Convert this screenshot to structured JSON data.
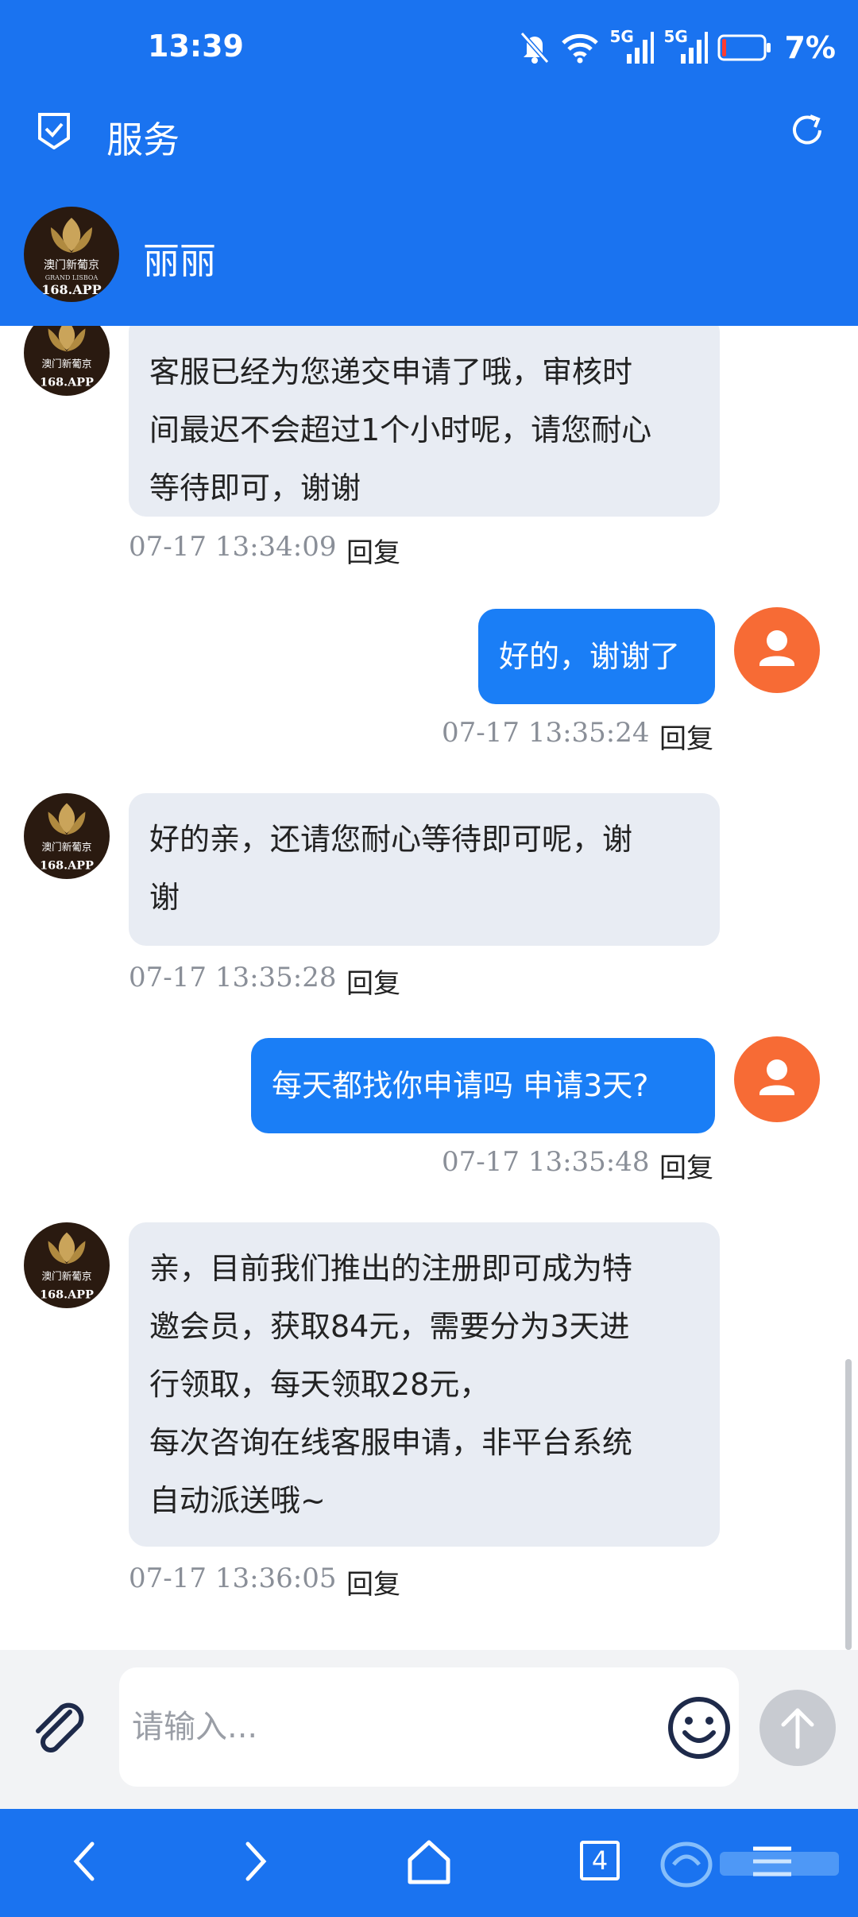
{
  "status_bar": {
    "time": "13:39",
    "signal1_label": "5G",
    "signal2_label": "5G",
    "battery": "7%"
  },
  "header": {
    "title": "服务",
    "agent_name": "丽丽"
  },
  "colors": {
    "primary": "#1a73f0",
    "out_bubble": "#1a7ef6",
    "in_bubble": "#e8ecf3",
    "user_avatar": "#f76b35"
  },
  "messages": [
    {
      "from": "agent",
      "lines": [
        "客服已经为您递交申请了哦，审核时",
        "间最迟不会超过1个小时呢，请您耐心",
        "等待即可，谢谢"
      ],
      "time": "07-17 13:34:09",
      "reply": "回复"
    },
    {
      "from": "user",
      "lines": [
        "好的，谢谢了"
      ],
      "time": "07-17 13:35:24",
      "reply": "回复"
    },
    {
      "from": "agent",
      "lines": [
        "好的亲，还请您耐心等待即可呢，谢",
        "谢"
      ],
      "time": "07-17 13:35:28",
      "reply": "回复"
    },
    {
      "from": "user",
      "lines": [
        "每天都找你申请吗 申请3天?"
      ],
      "time": "07-17 13:35:48",
      "reply": "回复"
    },
    {
      "from": "agent",
      "lines": [
        "亲，目前我们推出的注册即可成为特",
        "邀会员，获取84元，需要分为3天进",
        "行领取，每天领取28元，",
        "每次咨询在线客服申请，非平台系统",
        "自动派送哦~"
      ],
      "time": "07-17 13:36:05",
      "reply": "回复"
    }
  ],
  "agent_avatar": {
    "logo_line1": "澳门新葡京",
    "logo_line2": "GRAND LISBOA",
    "logo_line3": "168.APP"
  },
  "input": {
    "placeholder": "请输入..."
  },
  "nav": {
    "tab_count": "4"
  },
  "icons": {
    "status": [
      "mute-bell-icon",
      "wifi-icon",
      "signal-icon",
      "battery-icon"
    ],
    "header": [
      "checkbox-icon",
      "refresh-icon"
    ],
    "input": [
      "attachment-icon",
      "emoji-icon",
      "send-arrow-icon"
    ],
    "nav": [
      "back-icon",
      "forward-icon",
      "home-icon",
      "tabs-icon",
      "menu-icon"
    ]
  }
}
